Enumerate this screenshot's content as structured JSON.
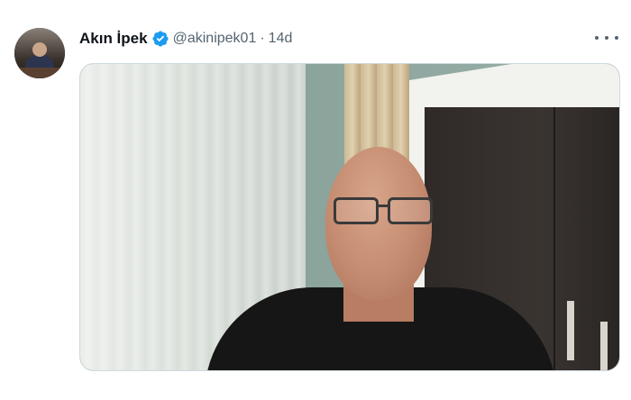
{
  "tweet": {
    "author_name": "Akın İpek",
    "handle": "@akinipek01",
    "separator": "·",
    "time": "14d"
  },
  "icons": {
    "verified": "verified-badge-icon",
    "more": "more-options-icon"
  },
  "colors": {
    "verified_blue": "#1d9bf0",
    "secondary_text": "#536471",
    "primary_text": "#0f1419"
  }
}
